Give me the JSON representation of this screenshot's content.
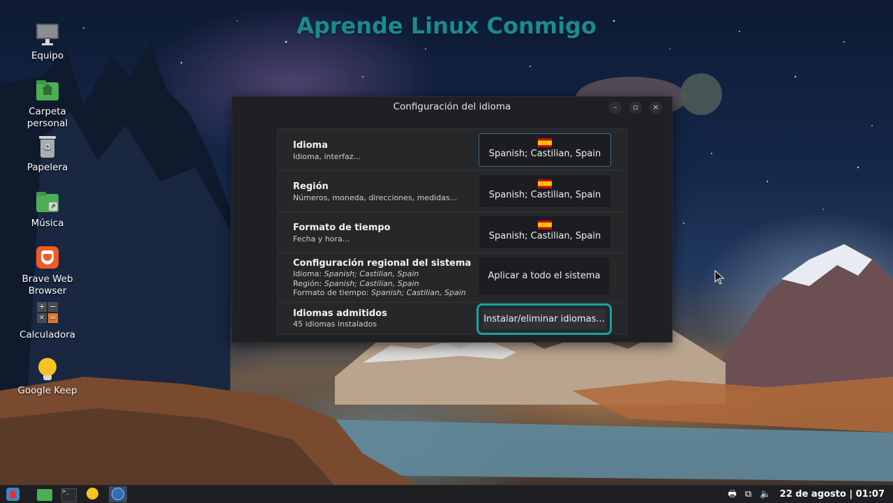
{
  "banner": {
    "text": "Aprende Linux Conmigo"
  },
  "desktop": {
    "icons": [
      {
        "label": "Equipo",
        "icon": "computer-icon"
      },
      {
        "label": "Carpeta personal",
        "icon": "home-folder-icon"
      },
      {
        "label": "Papelera",
        "icon": "trash-icon"
      },
      {
        "label": "Música",
        "icon": "music-folder-icon"
      },
      {
        "label": "Brave Web Browser",
        "icon": "brave-icon"
      },
      {
        "label": "Calculadora",
        "icon": "calculator-icon"
      },
      {
        "label": "Google Keep",
        "icon": "keep-icon"
      }
    ]
  },
  "window": {
    "title": "Configuración del idioma",
    "controls": [
      "–",
      "▫",
      "×"
    ],
    "rows": {
      "language": {
        "label": "Idioma",
        "desc": "Idioma, interfaz...",
        "value": "Spanish; Castilian, Spain"
      },
      "region": {
        "label": "Región",
        "desc": "Números, moneda, direcciones, medidas...",
        "value": "Spanish; Castilian, Spain"
      },
      "time": {
        "label": "Formato de tiempo",
        "desc": "Fecha y hora...",
        "value": "Spanish; Castilian, Spain"
      },
      "system": {
        "label": "Configuración regional del sistema",
        "lines": [
          {
            "prefix": "Idioma: ",
            "value": "Spanish; Castilian, Spain"
          },
          {
            "prefix": "Región: ",
            "value": "Spanish; Castilian, Spain"
          },
          {
            "prefix": "Formato de tiempo: ",
            "value": "Spanish; Castilian, Spain"
          }
        ],
        "button": "Aplicar a todo el sistema"
      },
      "supported": {
        "label": "Idiomas admitidos",
        "desc": "45 idiomas instalados",
        "button": "Instalar/eliminar idiomas..."
      }
    }
  },
  "taskbar": {
    "items": [
      "menu-icon",
      "files-icon",
      "terminal-icon",
      "keep-icon",
      "language-settings-icon"
    ],
    "tray": {
      "clock": "22 de agosto | 01:07"
    }
  },
  "colors": {
    "banner": "#1a8b8f",
    "highlight": "#13a3a6",
    "window_bg": "#1f2023"
  }
}
